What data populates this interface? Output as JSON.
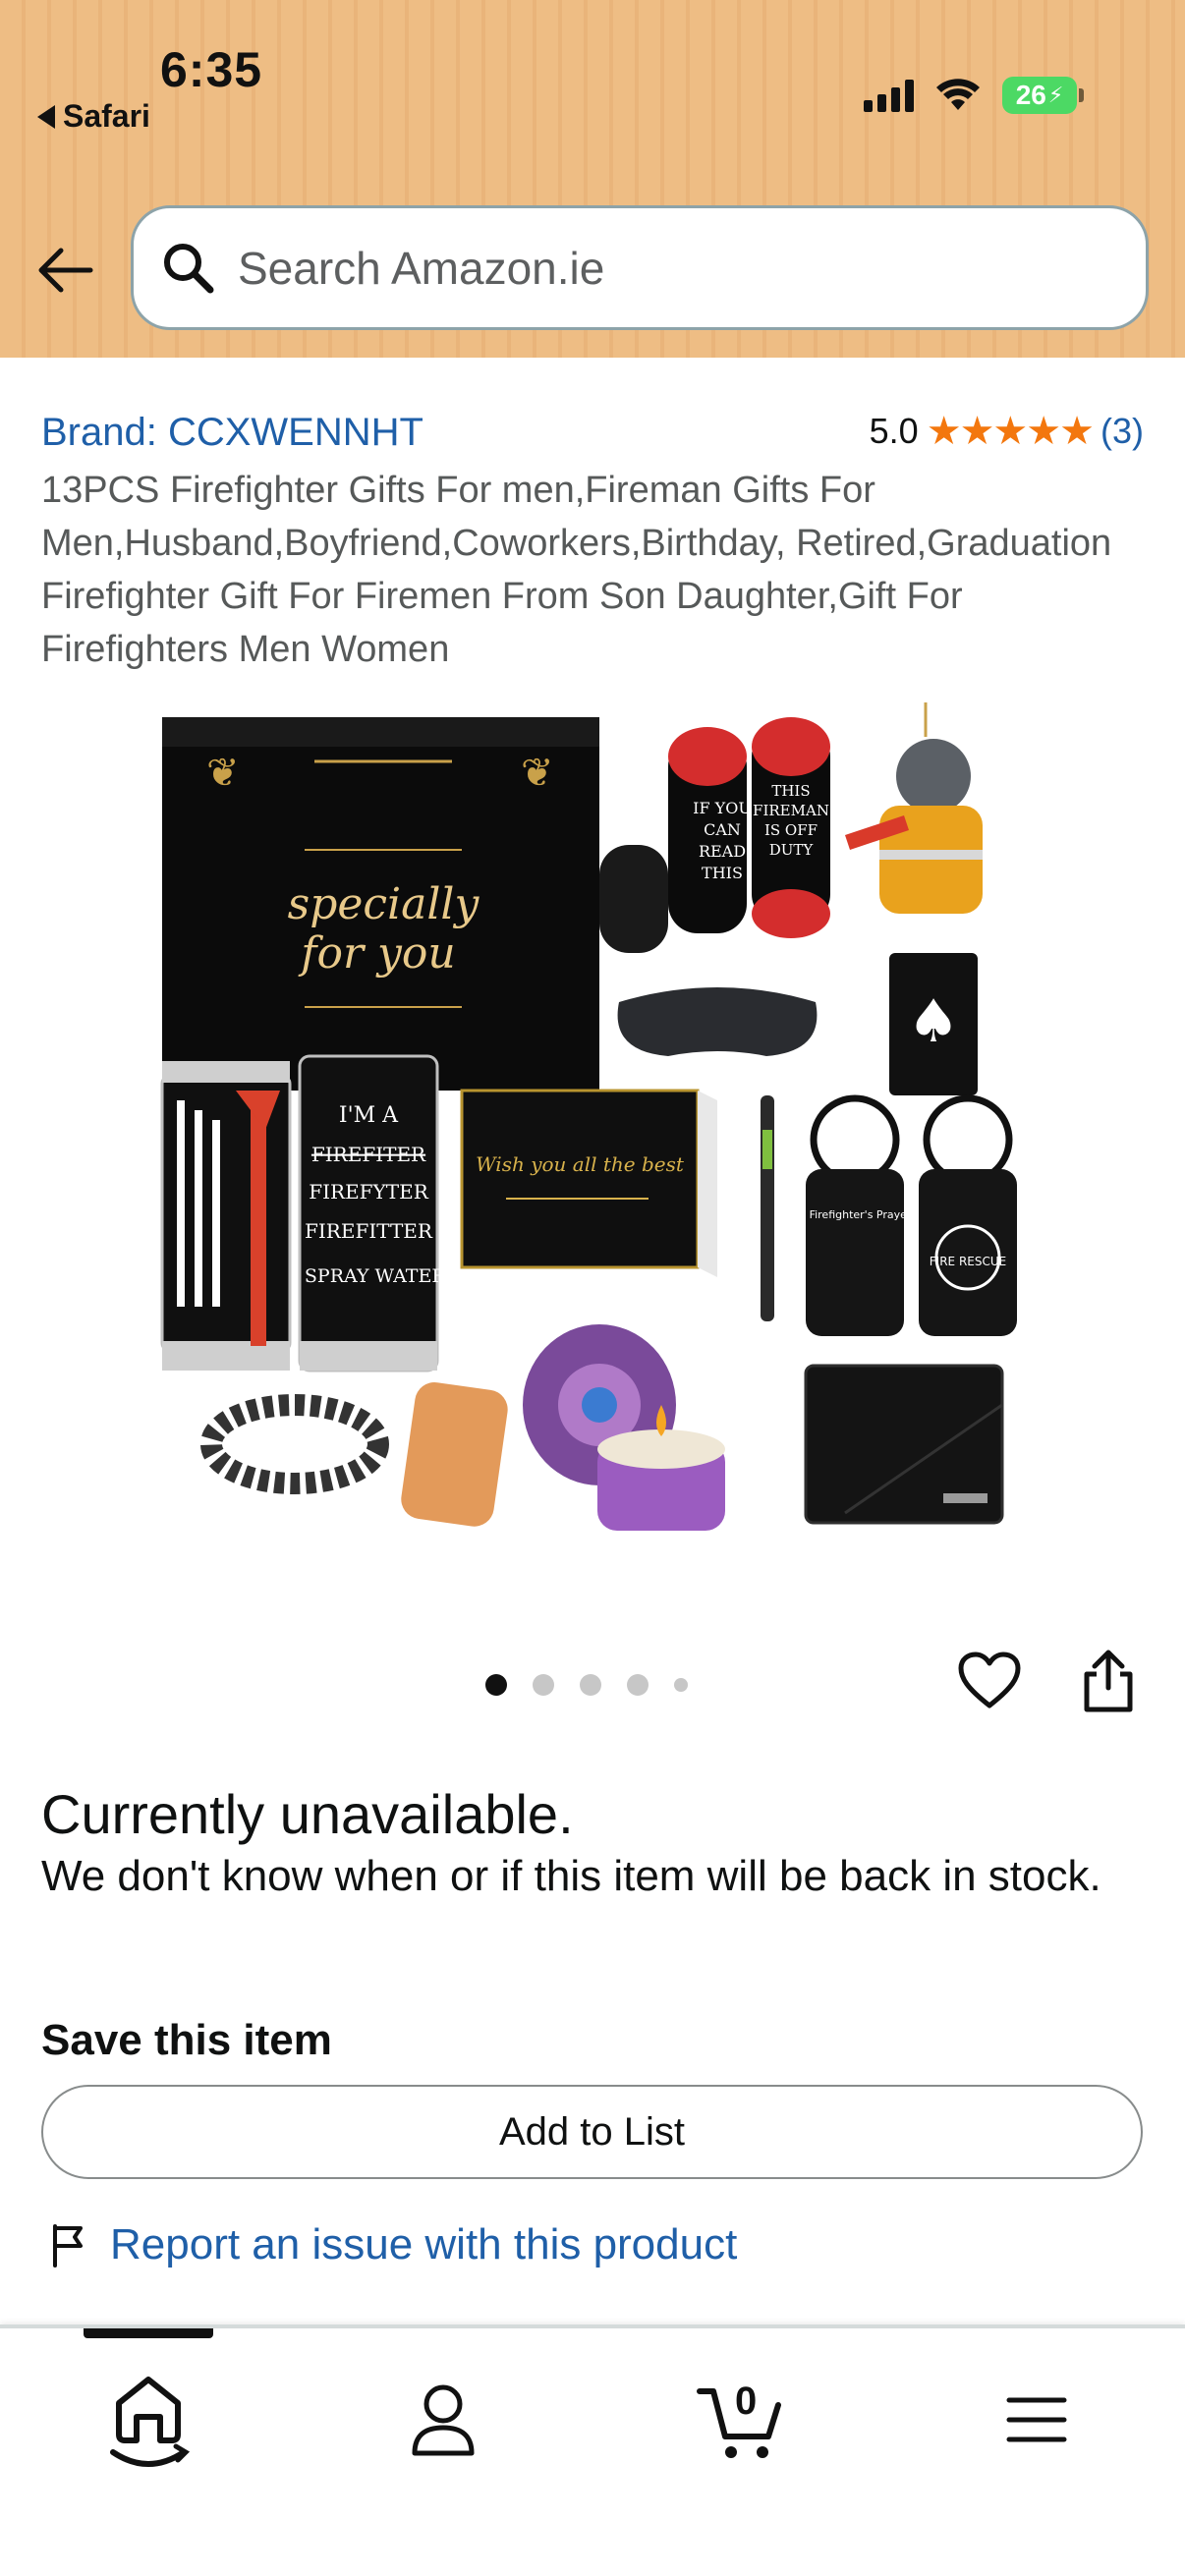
{
  "status_bar": {
    "time": "6:35",
    "back_app": "Safari",
    "battery": "26"
  },
  "search": {
    "placeholder": "Search Amazon.ie"
  },
  "product": {
    "brand": "Brand: CCXWENNHT",
    "rating_value": "5.0",
    "stars": "★★★★★",
    "rating_count": "(3)",
    "title": "13PCS Firefighter Gifts For men,Fireman Gifts For Men,Husband,Boyfriend,Coworkers,Birthday, Retired,Graduation Firefighter Gift For Firemen From Son Daughter,Gift For Firefighters Men Women",
    "image_text": {
      "box_line1": "specially",
      "box_line2": "for you",
      "card": "Wish you all the best",
      "tumbler_lines": [
        "I'M A",
        "FIREFITER",
        "FIREFYTER",
        "FIREFITTER",
        "I SPRAY WATER"
      ],
      "socks_left": [
        "IF YOU",
        "CAN",
        "READ",
        "THIS"
      ],
      "socks_right": [
        "THIS",
        "FIREMAN",
        "IS OFF",
        "DUTY"
      ],
      "keychain": "A Firefighter's Prayer",
      "tag": "FIRE RESCUE"
    }
  },
  "gallery": {
    "image_count": 5,
    "active_index": 0
  },
  "availability": {
    "heading": "Currently unavailable.",
    "text": "We don't know when or if this item will be back in stock."
  },
  "save": {
    "heading": "Save this item",
    "button_label": "Add to List"
  },
  "report_link": "Report an issue with this product",
  "tabbar": {
    "cart_count": "0",
    "items": [
      "home-icon",
      "account-icon",
      "cart-icon",
      "menu-icon"
    ]
  },
  "colors": {
    "header_bg": "#eebd84",
    "link": "#1f5fa8",
    "star": "#f3770e",
    "battery": "#4cd964"
  }
}
